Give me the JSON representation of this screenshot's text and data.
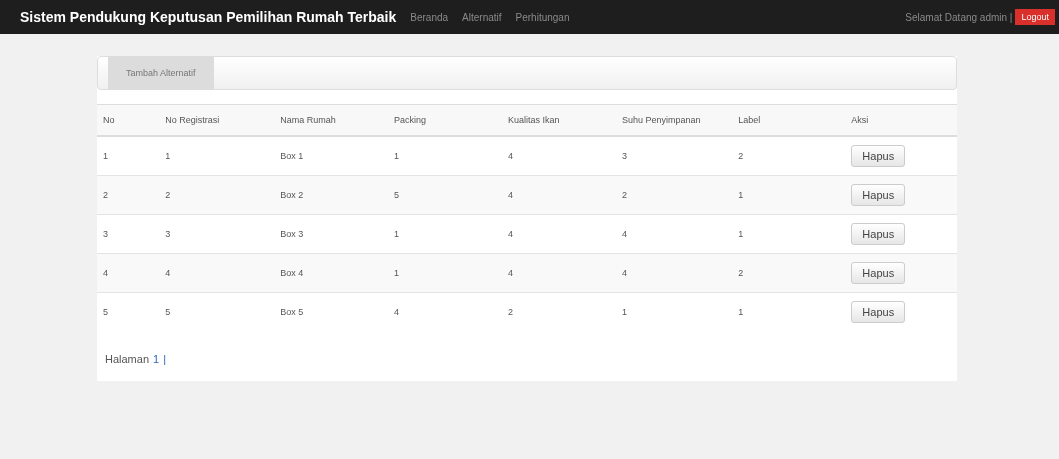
{
  "navbar": {
    "brand": "Sistem Pendukung Keputusan Pemilihan Rumah Terbaik",
    "links": [
      {
        "label": "Beranda",
        "selected": false
      },
      {
        "label": "Alternatif",
        "selected": false
      },
      {
        "label": "Perhitungan",
        "selected": false
      }
    ],
    "greeting": "Selamat Datang admin |",
    "logout": "Logout"
  },
  "tabs": [
    {
      "label": "Tambah Alternatif",
      "selected": true
    }
  ],
  "table": {
    "columns": [
      "No",
      "No Registrasi",
      "Nama Rumah",
      "Packing",
      "Kualitas Ikan",
      "Suhu Penyimpanan",
      "Label",
      "Aksi"
    ],
    "rows": [
      {
        "cells": [
          "1",
          "1",
          "Box 1",
          "1",
          "4",
          "3",
          "2"
        ],
        "action": "Hapus"
      },
      {
        "cells": [
          "2",
          "2",
          "Box 2",
          "5",
          "4",
          "2",
          "1"
        ],
        "action": "Hapus"
      },
      {
        "cells": [
          "3",
          "3",
          "Box 3",
          "1",
          "4",
          "4",
          "1"
        ],
        "action": "Hapus"
      },
      {
        "cells": [
          "4",
          "4",
          "Box 4",
          "1",
          "4",
          "4",
          "2"
        ],
        "action": "Hapus"
      },
      {
        "cells": [
          "5",
          "5",
          "Box 5",
          "4",
          "2",
          "1",
          "1"
        ],
        "action": "Hapus"
      }
    ]
  },
  "pagination": {
    "label": "Halaman",
    "pages": [
      {
        "label": "1",
        "selected": true
      }
    ],
    "separator": "|"
  }
}
